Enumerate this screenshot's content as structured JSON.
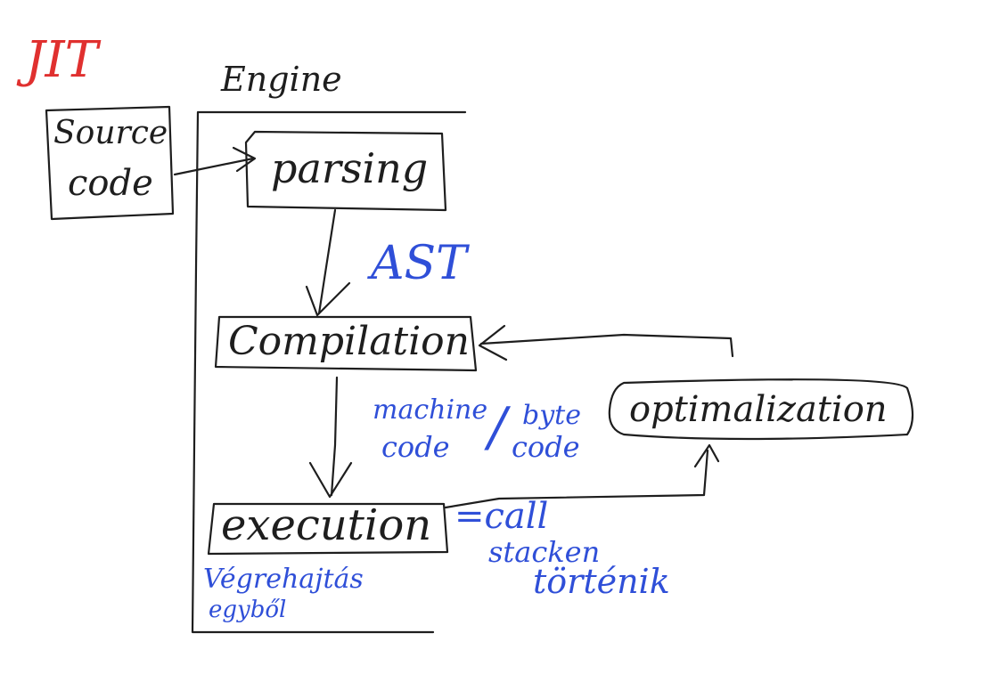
{
  "title": "JIT",
  "engine_label": "Engine",
  "boxes": {
    "source_line1": "Source",
    "source_line2": "code",
    "parsing": "parsing",
    "compilation": "Compilation",
    "execution": "execution",
    "optimization": "optimalization"
  },
  "annotations": {
    "ast": "AST",
    "machine": "machine",
    "code_left": "code",
    "slash": "/",
    "byte": "byte",
    "code_right": "code",
    "call": "=call",
    "stacken": "stacken",
    "tortenik": "történik",
    "vegrehajtas": "Végrehajtás",
    "egybol": "egyből"
  },
  "colors": {
    "ink": "#1e1e1e",
    "blue": "#2f4fd8",
    "red": "#e0302f"
  }
}
